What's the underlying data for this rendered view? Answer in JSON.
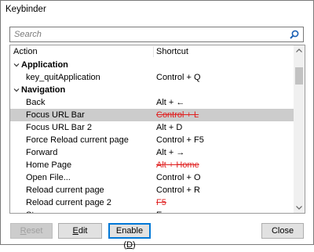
{
  "window": {
    "title": "Keybinder"
  },
  "search": {
    "placeholder": "Search",
    "icon": "search-icon"
  },
  "table": {
    "columns": {
      "action": "Action",
      "shortcut": "Shortcut"
    },
    "rows": [
      {
        "type": "category",
        "label": "Application",
        "expanded": true
      },
      {
        "type": "item",
        "action": "key_quitApplication",
        "shortcut": "Control + Q",
        "conflict": false,
        "selected": false
      },
      {
        "type": "category",
        "label": "Navigation",
        "expanded": true
      },
      {
        "type": "item",
        "action": "Back",
        "shortcut": "Alt + ←",
        "conflict": false,
        "selected": false
      },
      {
        "type": "item",
        "action": "Focus URL Bar",
        "shortcut": "Control + L",
        "conflict": true,
        "selected": true
      },
      {
        "type": "item",
        "action": "Focus URL Bar 2",
        "shortcut": "Alt + D",
        "conflict": false,
        "selected": false
      },
      {
        "type": "item",
        "action": "Force Reload current page",
        "shortcut": "Control + F5",
        "conflict": false,
        "selected": false
      },
      {
        "type": "item",
        "action": "Forward",
        "shortcut": "Alt + →",
        "conflict": false,
        "selected": false
      },
      {
        "type": "item",
        "action": "Home Page",
        "shortcut": "Alt + Home",
        "conflict": true,
        "selected": false
      },
      {
        "type": "item",
        "action": "Open File...",
        "shortcut": "Control + O",
        "conflict": false,
        "selected": false
      },
      {
        "type": "item",
        "action": "Reload current page",
        "shortcut": "Control + R",
        "conflict": false,
        "selected": false
      },
      {
        "type": "item",
        "action": "Reload current page 2",
        "shortcut": "F5",
        "conflict": true,
        "selected": false
      },
      {
        "type": "item",
        "action": "St...",
        "shortcut": "E...",
        "conflict": false,
        "selected": false
      }
    ]
  },
  "buttons": {
    "reset": {
      "label": "Reset",
      "mnemonic": "R",
      "rest": "eset",
      "enabled": false
    },
    "edit": {
      "label": "Edit",
      "mnemonic": "E",
      "rest": "dit",
      "enabled": true
    },
    "enable": {
      "label_pre": "Enable (",
      "mnemonic": "D",
      "label_post": ")",
      "enabled": true,
      "default": true
    },
    "close": {
      "label": "Close",
      "enabled": true
    }
  },
  "colors": {
    "conflict": "#e02020",
    "selected_row": "#cccccc",
    "default_button_border": "#0078d7"
  }
}
